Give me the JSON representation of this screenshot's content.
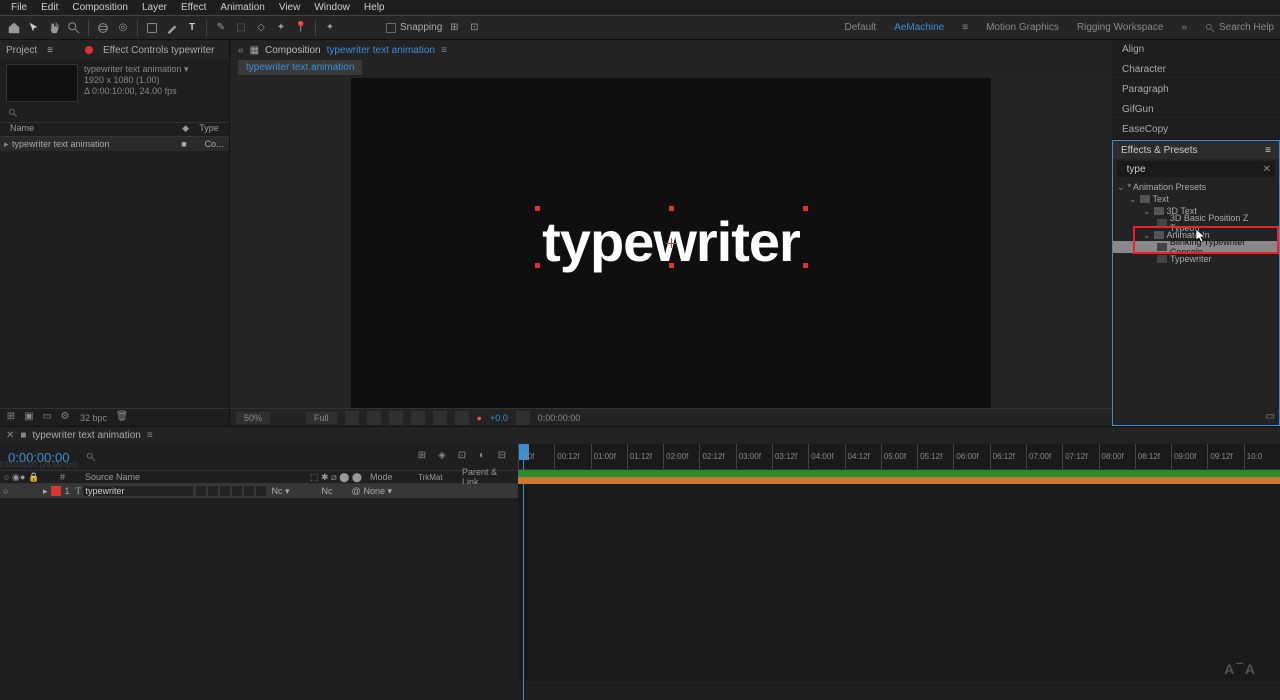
{
  "menu": [
    "File",
    "Edit",
    "Composition",
    "Layer",
    "Effect",
    "Animation",
    "View",
    "Window",
    "Help"
  ],
  "toolbar": {
    "snapping": "Snapping",
    "workspaces": [
      "Default",
      "AeMachine",
      "Motion Graphics",
      "Rigging Workspace"
    ],
    "active_ws": 1,
    "search_help": "Search Help"
  },
  "project": {
    "tab1": "Project",
    "tab2": "Effect Controls typewriter",
    "comp_name": "typewriter text animation",
    "comp_res": "1920 x 1080 (1.00)",
    "comp_dur": "Δ 0:00:10:00, 24.00 fps",
    "col_name": "Name",
    "col_type": "Type",
    "item": "typewriter text animation",
    "item_type": "Co...",
    "bpc": "32 bpc"
  },
  "composition": {
    "panel_label": "Composition",
    "comp_link": "typewriter text animation",
    "flow_crumb": "typewriter text animation",
    "text": "typewriter",
    "zoom": "50%",
    "quality": "Full",
    "color_val": "+0.0",
    "timecode": "0:00:00:00"
  },
  "right_panels": [
    "Align",
    "Character",
    "Paragraph",
    "GifGun",
    "EaseCopy"
  ],
  "effects": {
    "title": "Effects & Presets",
    "query": "type",
    "root": "* Animation Presets",
    "text_folder": "Text",
    "threed": "3D Text",
    "threed_item": "3D Basic Position Z Typeon",
    "animate_in": "Animate In",
    "blink": "Blinking Typewriter Console",
    "typewriter": "Typewriter"
  },
  "timeline": {
    "tab": "typewriter text animation",
    "tc": "0:00:00:00",
    "ghost": "0:00:00:00 (24.00 fps)",
    "col_num": "#",
    "col_src": "Source Name",
    "col_mode": "Mode",
    "col_trk": "TrkMat",
    "col_parent": "Parent & Link",
    "layer_num": "1",
    "layer_name": "typewriter",
    "layer_mode": "Nc",
    "layer_trk": "Nc",
    "layer_parent": "None",
    "marks": [
      ":00f",
      "00:12f",
      "01:00f",
      "01:12f",
      "02:00f",
      "02:12f",
      "03:00f",
      "03:12f",
      "04:00f",
      "04:12f",
      "05:00f",
      "05:12f",
      "06:00f",
      "06:12f",
      "07:00f",
      "07:12f",
      "08:00f",
      "08:12f",
      "09:00f",
      "09:12f",
      "10:0"
    ]
  },
  "watermark": "A‾A"
}
